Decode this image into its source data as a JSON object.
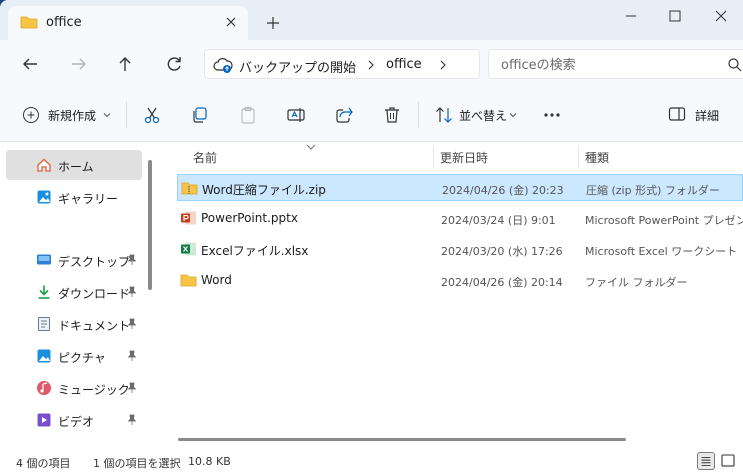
{
  "tab": {
    "title": "office"
  },
  "address": {
    "crumb_root": "バックアップの開始",
    "crumb_current": "office"
  },
  "search": {
    "placeholder": "officeの検索"
  },
  "commandbar": {
    "new_label": "新規作成",
    "sort_label": "並べ替え",
    "details_label": "詳細"
  },
  "sidebar": {
    "items": [
      {
        "label": "ホーム",
        "icon": "home-icon",
        "pinned": false,
        "selected": true
      },
      {
        "label": "ギャラリー",
        "icon": "gallery-icon",
        "pinned": false,
        "selected": false
      },
      {
        "label": "デスクトップ",
        "icon": "desktop-icon",
        "pinned": true,
        "selected": false
      },
      {
        "label": "ダウンロード",
        "icon": "download-icon",
        "pinned": true,
        "selected": false
      },
      {
        "label": "ドキュメント",
        "icon": "documents-icon",
        "pinned": true,
        "selected": false
      },
      {
        "label": "ピクチャ",
        "icon": "pictures-icon",
        "pinned": true,
        "selected": false
      },
      {
        "label": "ミュージック",
        "icon": "music-icon",
        "pinned": true,
        "selected": false
      },
      {
        "label": "ビデオ",
        "icon": "video-icon",
        "pinned": true,
        "selected": false
      }
    ]
  },
  "filelist": {
    "columns": {
      "name": "名前",
      "date": "更新日時",
      "type": "種類"
    },
    "rows": [
      {
        "name": "Word圧縮ファイル.zip",
        "date": "2024/04/26 (金) 20:23",
        "type": "圧縮 (zip 形式) フォルダー",
        "icon": "zip-folder-icon",
        "selected": true
      },
      {
        "name": "PowerPoint.pptx",
        "date": "2024/03/24 (日) 9:01",
        "type": "Microsoft PowerPoint プレゼンテ",
        "icon": "powerpoint-icon",
        "selected": false
      },
      {
        "name": "Excelファイル.xlsx",
        "date": "2024/03/20 (水) 17:26",
        "type": "Microsoft Excel ワークシート",
        "icon": "excel-icon",
        "selected": false
      },
      {
        "name": "Word",
        "date": "2024/04/26 (金) 20:14",
        "type": "ファイル フォルダー",
        "icon": "folder-icon",
        "selected": false
      }
    ]
  },
  "status": {
    "item_count": "4 個の項目",
    "selected": "1 個の項目を選択",
    "size": "10.8 KB"
  },
  "colors": {
    "accent": "#0067c0",
    "selection": "#cce8ff",
    "folder": "#f8c446"
  }
}
